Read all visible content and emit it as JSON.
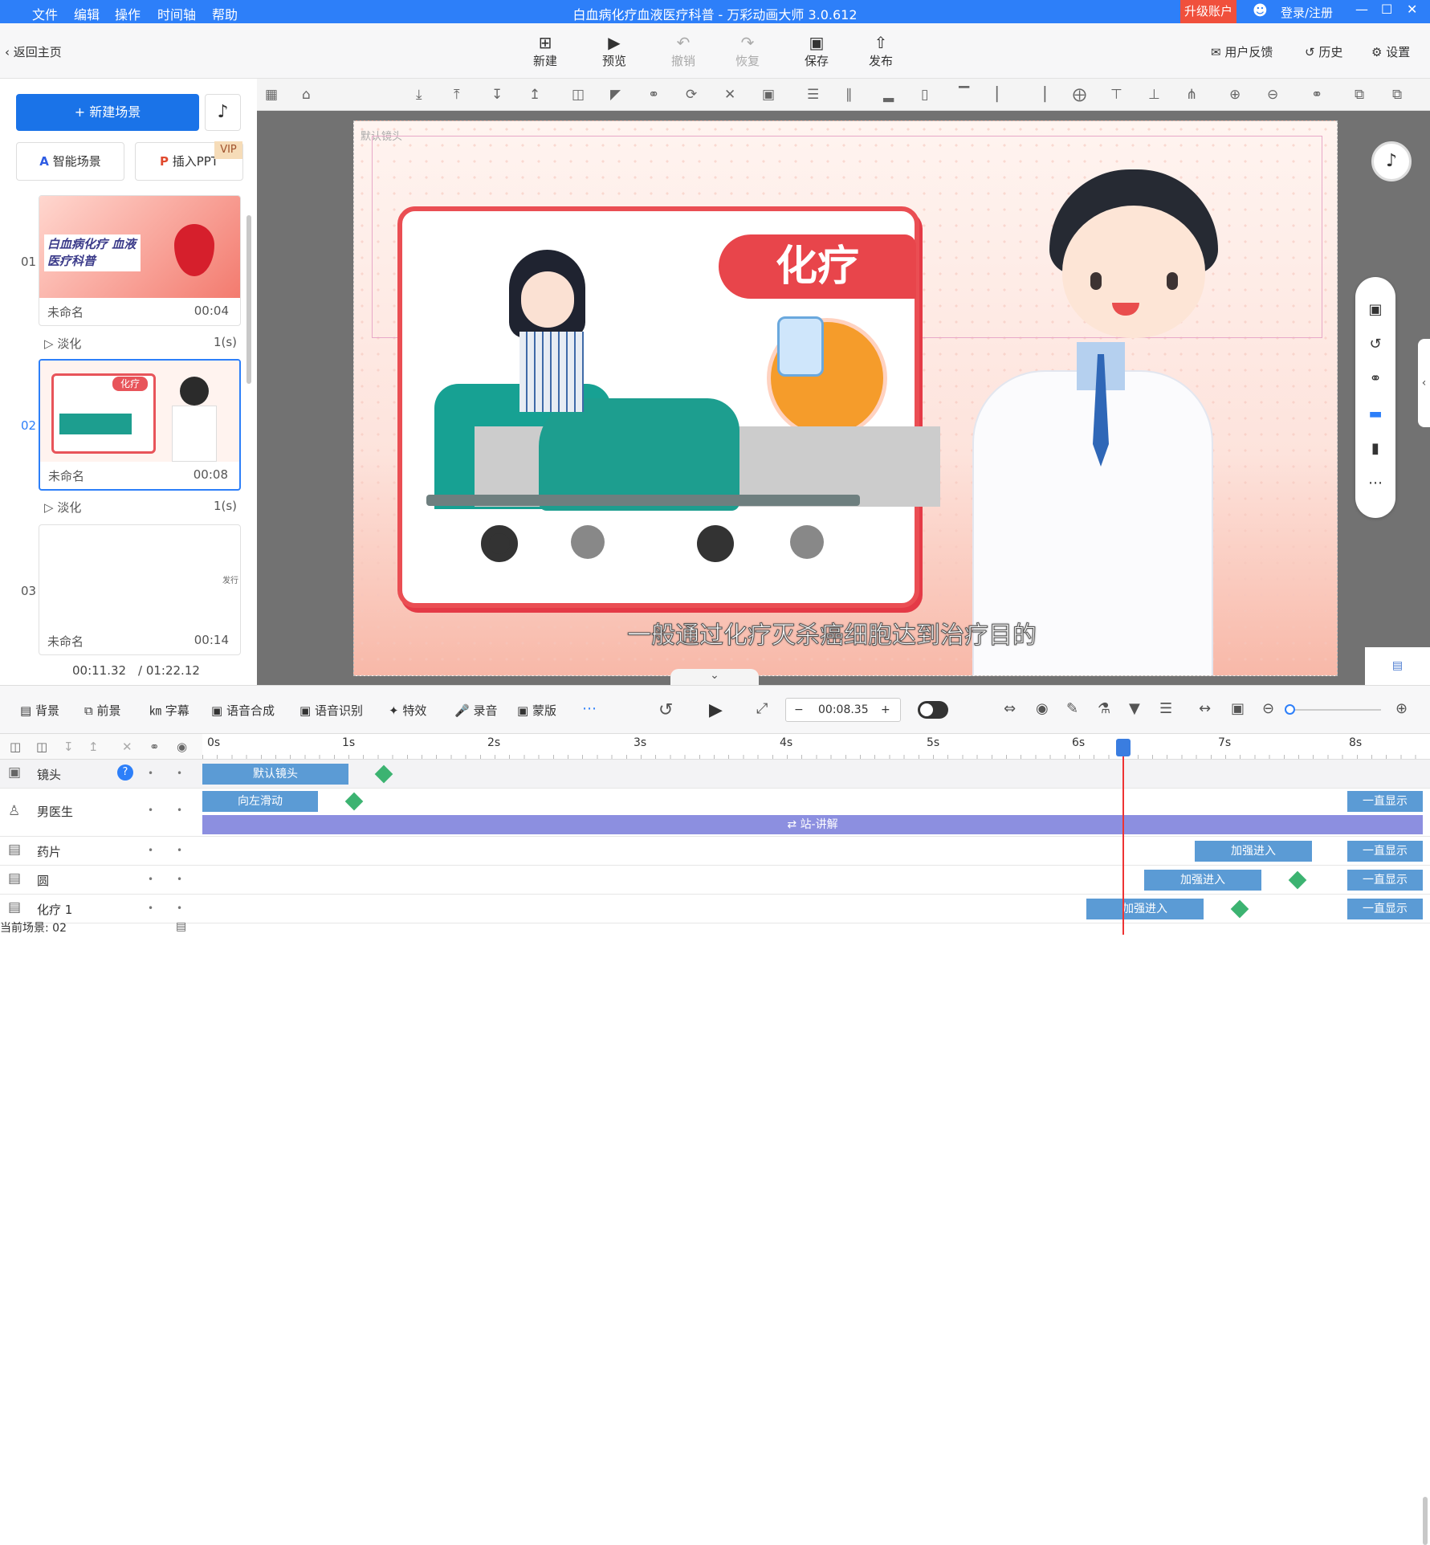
{
  "titlebar": {
    "menus": [
      "文件",
      "编辑",
      "操作",
      "时间轴",
      "帮助"
    ],
    "title": "白血病化疗血液医疗科普 - 万彩动画大师 3.0.612",
    "upgrade": "升级账户",
    "login": "登录/注册",
    "controls": [
      "—",
      "☐",
      "✕"
    ]
  },
  "toolbar": {
    "back": "返回主页",
    "new": "新建",
    "preview": "预览",
    "undo": "撤销",
    "redo": "恢复",
    "save": "保存",
    "publish": "发布",
    "feedback": "用户反馈",
    "history": "历史",
    "settings": "设置"
  },
  "left": {
    "new_scene": "新建场景",
    "smart_scene": "智能场景",
    "insert_ppt": "插入PPT",
    "vip": "VIP",
    "scenes": [
      {
        "num": "01",
        "name": "未命名",
        "time": "00:04",
        "thumb_text": "白血病化疗 血液医疗科普"
      },
      {
        "num": "02",
        "name": "未命名",
        "time": "00:08",
        "thumb_text": "化疗"
      },
      {
        "num": "03",
        "name": "未命名",
        "time": "00:14",
        "thumb_text": "发行"
      }
    ],
    "transitions": [
      {
        "name": "淡化",
        "duration": "1(s)"
      },
      {
        "name": "淡化",
        "duration": "1(s)"
      }
    ],
    "current_time": "00:11.32",
    "total_time": "/ 01:22.12"
  },
  "canvas": {
    "camera_label": "默认镜头",
    "card_title": "化疗",
    "subtitle": "一般通过化疗灭杀癌细胞达到治疗目的"
  },
  "timeline_toolbar": {
    "tools": [
      "背景",
      "前景",
      "字幕",
      "语音合成",
      "语音识别",
      "特效",
      "录音",
      "蒙版"
    ],
    "time": "00:08.35",
    "minus": "−",
    "plus": "+"
  },
  "timeline": {
    "seconds": [
      "0s",
      "1s",
      "2s",
      "3s",
      "4s",
      "5s",
      "6s",
      "7s",
      "8s"
    ],
    "rows": [
      {
        "name": "镜头",
        "bars": [
          "默认镜头"
        ]
      },
      {
        "name": "男医生",
        "bars": [
          "向左滑动",
          "一直显示",
          "站-讲解"
        ]
      },
      {
        "name": "药片",
        "bars": [
          "加强进入",
          "一直显示"
        ]
      },
      {
        "name": "圆",
        "bars": [
          "加强进入",
          "一直显示"
        ]
      },
      {
        "name": "化疗 1",
        "bars": [
          "加强进入",
          "一直显示"
        ]
      }
    ],
    "status": "当前场景: 02"
  },
  "colors": {
    "accent": "#2d7ff9",
    "upgrade": "#f0503c",
    "track_blue": "#5b9bd5",
    "track_purple": "#8c8fe0",
    "playhead": "#ee3333",
    "keyframe": "#3cb371"
  }
}
